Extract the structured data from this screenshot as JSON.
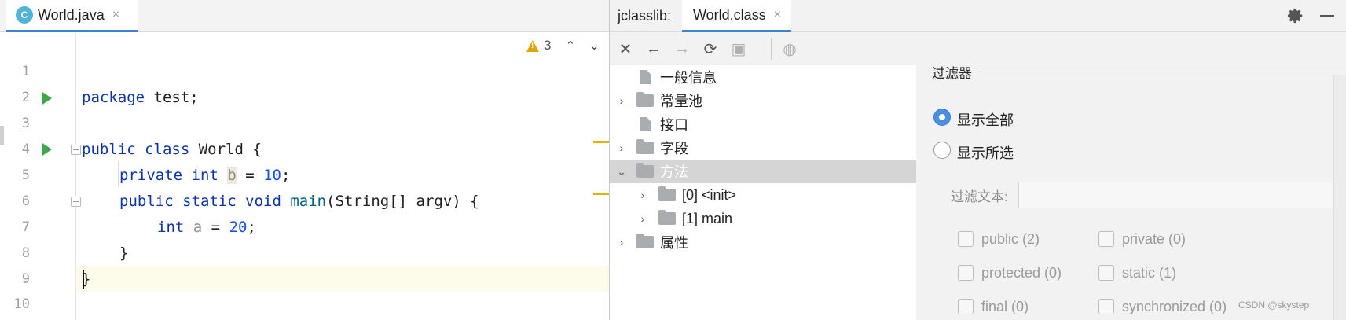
{
  "editor": {
    "tab": {
      "icon": "java-class-icon",
      "icon_letter": "C",
      "label": "World.java",
      "close": "×"
    },
    "inspections": {
      "warning_count": "3",
      "prev": "⌃",
      "next": "⌄"
    },
    "lines": [
      {
        "n": "1"
      },
      {
        "n": "2"
      },
      {
        "n": "3"
      },
      {
        "n": "4"
      },
      {
        "n": "5"
      },
      {
        "n": "6"
      },
      {
        "n": "7"
      },
      {
        "n": "8"
      },
      {
        "n": "9"
      },
      {
        "n": "10"
      }
    ],
    "code": {
      "l1_kw": "package",
      "l1_rest": " test;",
      "l3_kw": "public class",
      "l3_rest": " World {",
      "l4_kw": "private int",
      "l4_var": "b",
      "l4_eq": " = ",
      "l4_num": "10",
      "l4_end": ";",
      "l5_kw": "public static void",
      "l5_fn": "main",
      "l5_rest": "(String[] argv) {",
      "l6_kw": "int",
      "l6_var": "a",
      "l6_eq": " = ",
      "l6_num": "20",
      "l6_end": ";",
      "l7": "}",
      "l8": "}"
    },
    "colors": {
      "keyword": "#0b34a8",
      "number": "#1750eb",
      "function": "#00627a",
      "run": "#3fa64a",
      "warning": "#e2a508"
    }
  },
  "jclasslib": {
    "title": "jclasslib:",
    "tab": {
      "label": "World.class",
      "close": "×"
    },
    "toolbar": [
      {
        "name": "close-icon",
        "glyph": "✕",
        "disabled": false
      },
      {
        "name": "back-icon",
        "glyph": "←",
        "disabled": false
      },
      {
        "name": "forward-icon",
        "glyph": "→",
        "disabled": true
      },
      {
        "name": "refresh-icon",
        "glyph": "⟳",
        "disabled": false
      },
      {
        "name": "save-icon",
        "glyph": "▣",
        "disabled": true
      },
      {
        "name": "globe-icon",
        "glyph": "◍",
        "disabled": true
      }
    ],
    "tree": [
      {
        "label": "一般信息",
        "type": "file",
        "twisty": "",
        "level": 0
      },
      {
        "label": "常量池",
        "type": "folder",
        "twisty": "›",
        "level": 0
      },
      {
        "label": "接口",
        "type": "file",
        "twisty": "",
        "level": 0
      },
      {
        "label": "字段",
        "type": "folder",
        "twisty": "›",
        "level": 0
      },
      {
        "label": "方法",
        "type": "folder",
        "twisty": "⌄",
        "level": 0,
        "selected": true
      },
      {
        "label": "[0] <init>",
        "type": "folder",
        "twisty": "›",
        "level": 1
      },
      {
        "label": "[1] main",
        "type": "folder",
        "twisty": "›",
        "level": 1
      },
      {
        "label": "属性",
        "type": "folder",
        "twisty": "›",
        "level": 0
      }
    ],
    "filter": {
      "title": "过滤器",
      "radio_all": "显示全部",
      "radio_selected": "显示所选",
      "text_label": "过滤文本:",
      "checkboxes": [
        "public (2)",
        "private (0)",
        "protected (0)",
        "static (1)",
        "final (0)",
        "synchronized (0)"
      ]
    }
  },
  "watermark": "CSDN @skystep"
}
